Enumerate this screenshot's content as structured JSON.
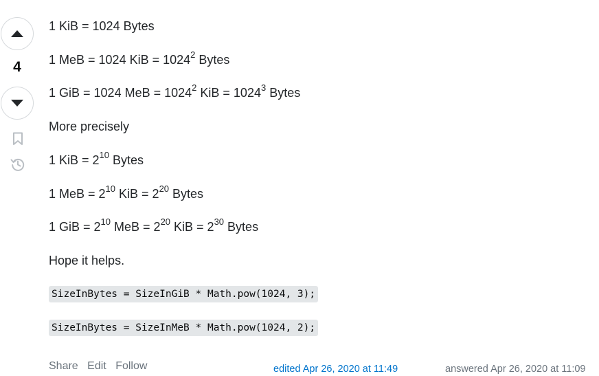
{
  "votes": {
    "count": "4",
    "upvote_icon": "triangle-up-icon",
    "downvote_icon": "triangle-down-icon",
    "bookmark_icon": "bookmark-icon",
    "history_icon": "history-icon"
  },
  "answer": {
    "lines": [
      {
        "parts": [
          "1 KiB = 1024 Bytes"
        ]
      },
      {
        "parts": [
          "1 MeB = 1024 KiB = 1024",
          "2",
          " Bytes"
        ]
      },
      {
        "parts": [
          "1 GiB = 1024 MeB = 1024",
          "2",
          " KiB = 1024",
          "3",
          " Bytes"
        ]
      },
      {
        "parts": [
          "More precisely"
        ]
      },
      {
        "parts": [
          "1 KiB = 2",
          "10",
          " Bytes"
        ]
      },
      {
        "parts": [
          "1 MeB = 2",
          "10",
          " KiB = 2",
          "20",
          " Bytes"
        ]
      },
      {
        "parts": [
          "1 GiB = 2",
          "10",
          " MeB = 2",
          "20",
          " KiB = 2",
          "30",
          " Bytes"
        ]
      },
      {
        "parts": [
          "Hope it helps."
        ]
      }
    ],
    "code": [
      "SizeInBytes = SizeInGiB * Math.pow(1024, 3);",
      "SizeInBytes = SizeInMeB * Math.pow(1024, 2);"
    ]
  },
  "menu": {
    "share": "Share",
    "edit": "Edit",
    "follow": "Follow"
  },
  "meta": {
    "edited": "edited Apr 26, 2020 at 11:49",
    "answered": "answered Apr 26, 2020 at 11:09"
  }
}
